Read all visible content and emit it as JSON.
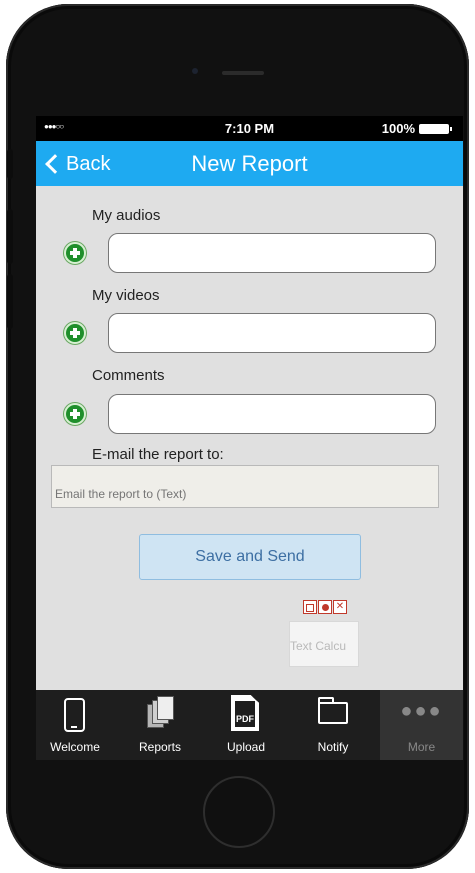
{
  "status_bar": {
    "signal": "●●●○○",
    "time": "7:10 PM",
    "battery": "100%"
  },
  "nav": {
    "back_label": "Back",
    "title": "New Report"
  },
  "form": {
    "audios_label": "My audios",
    "audios_value": "",
    "videos_label": "My videos",
    "videos_value": "",
    "comments_label": "Comments",
    "comments_value": "",
    "email_label": "E-mail the report to:",
    "email_placeholder": "Email the report to (Text)",
    "save_button": "Save and Send"
  },
  "widget": {
    "text": "Text Calcu"
  },
  "tabs": [
    {
      "label": "Welcome"
    },
    {
      "label": "Reports"
    },
    {
      "label": "Upload",
      "icon_text": "PDF"
    },
    {
      "label": "Notify"
    },
    {
      "label": "More",
      "icon_text": "●●●"
    }
  ],
  "colors": {
    "nav_bar": "#1eaaf1",
    "add_icon": "#1f8f2b",
    "tab_bar": "#1e1e1e"
  }
}
